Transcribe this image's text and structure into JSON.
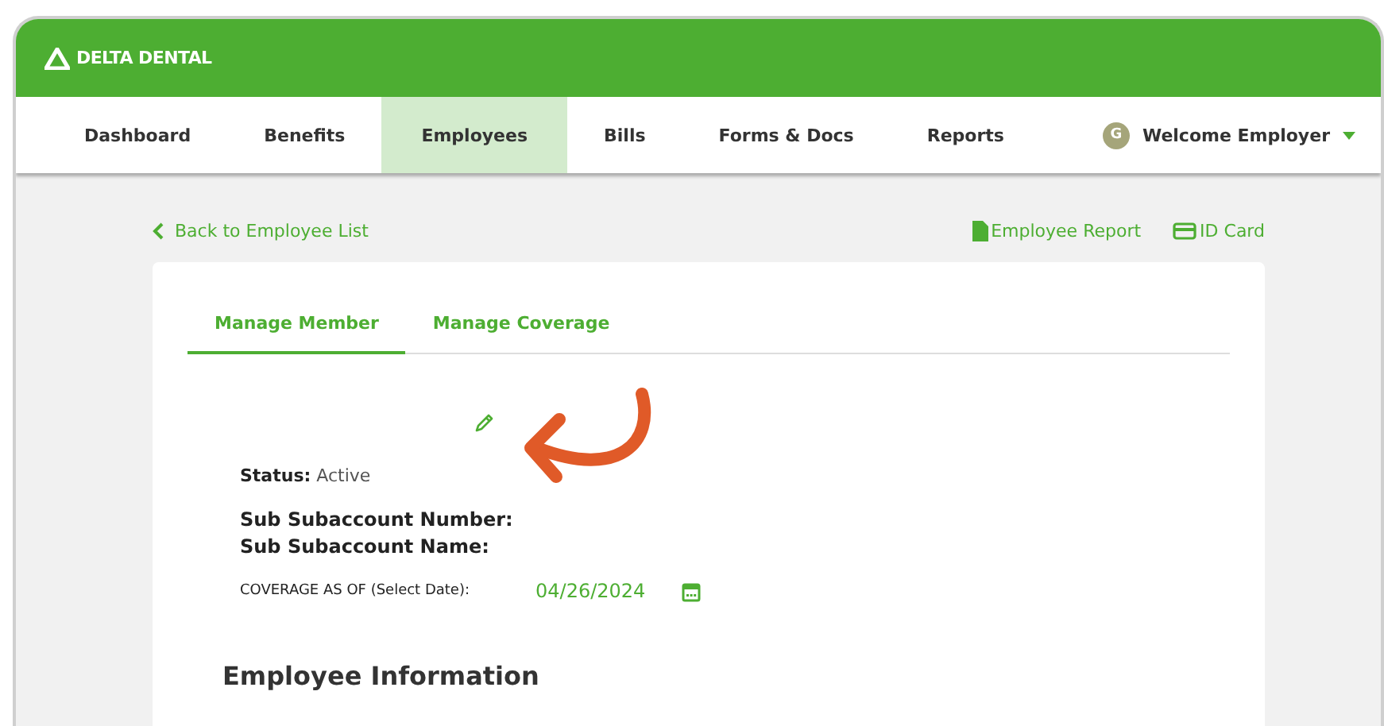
{
  "header": {
    "logo": "DELTA DENTAL"
  },
  "nav": {
    "items": [
      {
        "label": "Dashboard",
        "selected": false
      },
      {
        "label": "Benefits",
        "selected": false
      },
      {
        "label": "Employees",
        "selected": true
      },
      {
        "label": "Bills",
        "selected": false
      },
      {
        "label": "Forms & Docs",
        "selected": false
      },
      {
        "label": "Reports",
        "selected": false
      }
    ],
    "user": {
      "avatar": "G",
      "label": "Welcome Employer"
    }
  },
  "toolbar": {
    "back": "Back to Employee List",
    "links": [
      {
        "kind": "report",
        "label": "Employee Report"
      },
      {
        "kind": "card",
        "label": "ID Card"
      }
    ]
  },
  "tabs": [
    {
      "label": "Manage Member",
      "selected": true
    },
    {
      "label": "Manage Coverage",
      "selected": false
    }
  ],
  "member": {
    "status_label": "Status:",
    "status_value": "Active",
    "fields": [
      "Sub Subaccount Number:",
      "Sub Subaccount Name:"
    ],
    "coverage_label": "COVERAGE AS OF (Select Date):",
    "coverage_date": "04/26/2024"
  },
  "section_title": "Employee Information"
}
